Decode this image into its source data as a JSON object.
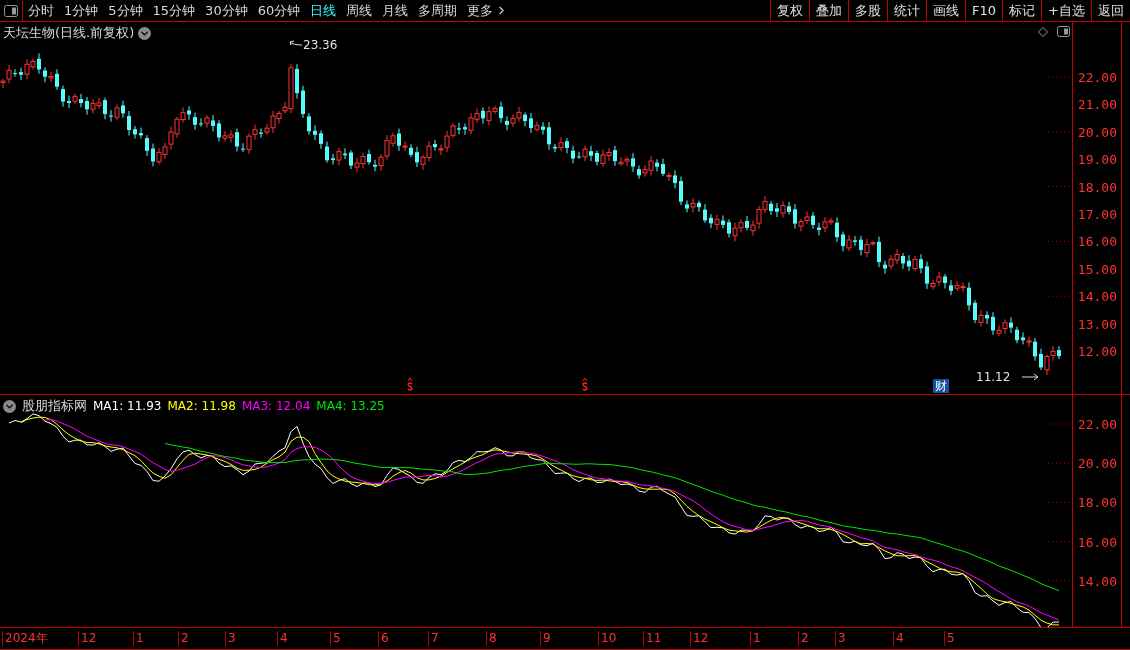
{
  "toolbar": {
    "periods": [
      {
        "label": "分时",
        "selected": false
      },
      {
        "label": "1分钟",
        "selected": false
      },
      {
        "label": "5分钟",
        "selected": false
      },
      {
        "label": "15分钟",
        "selected": false
      },
      {
        "label": "30分钟",
        "selected": false
      },
      {
        "label": "60分钟",
        "selected": false
      },
      {
        "label": "日线",
        "selected": true
      },
      {
        "label": "周线",
        "selected": false
      },
      {
        "label": "月线",
        "selected": false
      },
      {
        "label": "多周期",
        "selected": false
      },
      {
        "label": "更多",
        "selected": false
      }
    ],
    "actions": [
      "复权",
      "叠加",
      "多股",
      "统计",
      "画线",
      "F10",
      "标记",
      "+自选",
      "返回"
    ]
  },
  "price_panel": {
    "title": "天坛生物(日线.前复权)",
    "high_label": "23.36",
    "low_label": "11.12",
    "event_badge": "财",
    "y_axis": [
      "22.00",
      "21.00",
      "20.00",
      "19.00",
      "18.00",
      "17.00",
      "16.00",
      "15.00",
      "14.00",
      "13.00",
      "12.00"
    ]
  },
  "indicator_panel": {
    "name": "股朋指标网",
    "series": [
      {
        "label": "MA1:",
        "value": "11.93",
        "color": "#ffffff"
      },
      {
        "label": "MA2:",
        "value": "11.98",
        "color": "#ffff00"
      },
      {
        "label": "MA3:",
        "value": "12.04",
        "color": "#ff00ff"
      },
      {
        "label": "MA4:",
        "value": "13.25",
        "color": "#00e600"
      }
    ],
    "y_axis": [
      "22.00",
      "20.00",
      "18.00",
      "16.00",
      "14.00"
    ]
  },
  "date_axis": [
    "2024年",
    "12",
    "1",
    "2",
    "3",
    "4",
    "5",
    "6",
    "7",
    "8",
    "9",
    "10",
    "11",
    "12",
    "1",
    "2",
    "3",
    "4",
    "5"
  ]
}
